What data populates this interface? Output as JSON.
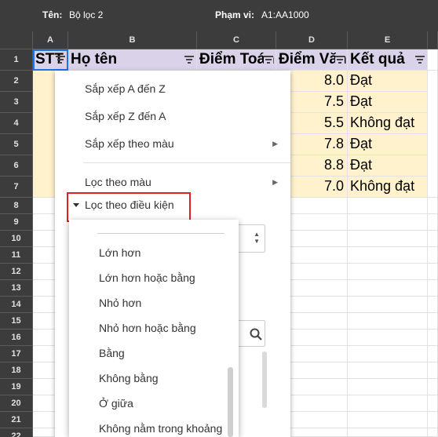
{
  "filter": {
    "name_label": "Tên:",
    "name_value": "Bộ lọc 2",
    "range_label": "Phạm vi:",
    "range_value": "A1:AA1000"
  },
  "columns": [
    "A",
    "B",
    "C",
    "D",
    "E"
  ],
  "rows": [
    "1",
    "2",
    "3",
    "4",
    "5",
    "6",
    "7",
    "8",
    "9",
    "10",
    "11",
    "12",
    "13",
    "14",
    "15",
    "16",
    "17",
    "18",
    "19",
    "20",
    "21",
    "22"
  ],
  "header_row": {
    "a": "STT",
    "b": "Họ tên",
    "c": "Điểm Toán",
    "d": "Điểm Văn",
    "e": "Kết quả"
  },
  "data_rows": [
    {
      "d": "8.0",
      "e": "Đạt"
    },
    {
      "d": "7.5",
      "e": "Đạt"
    },
    {
      "d": "5.5",
      "e": "Không đạt"
    },
    {
      "d": "7.8",
      "e": "Đạt"
    },
    {
      "d": "8.8",
      "e": "Đạt"
    },
    {
      "d": "7.0",
      "e": "Không đạt"
    }
  ],
  "menu": {
    "sort_az": "Sắp xếp A đến Z",
    "sort_za": "Sắp xếp Z đến A",
    "sort_color": "Sắp xếp theo màu",
    "filter_color": "Lọc theo màu",
    "filter_condition": "Lọc theo điều kiện"
  },
  "conditions": [
    "Lớn hơn",
    "Lớn hơn hoặc bằng",
    "Nhỏ hơn",
    "Nhỏ hơn hoặc bằng",
    "Bằng",
    "Không bằng",
    "Ở giữa",
    "Không nằm trong khoảng"
  ],
  "colors": {
    "header_fill": "#d9d2e9",
    "data_fill": "#fff2cc",
    "highlight_border": "#e02020",
    "selection": "#1a73e8"
  },
  "icons": [
    "filter-icon",
    "search-icon",
    "caret-down-icon",
    "chevron-right-icon",
    "select-arrows-icon"
  ]
}
